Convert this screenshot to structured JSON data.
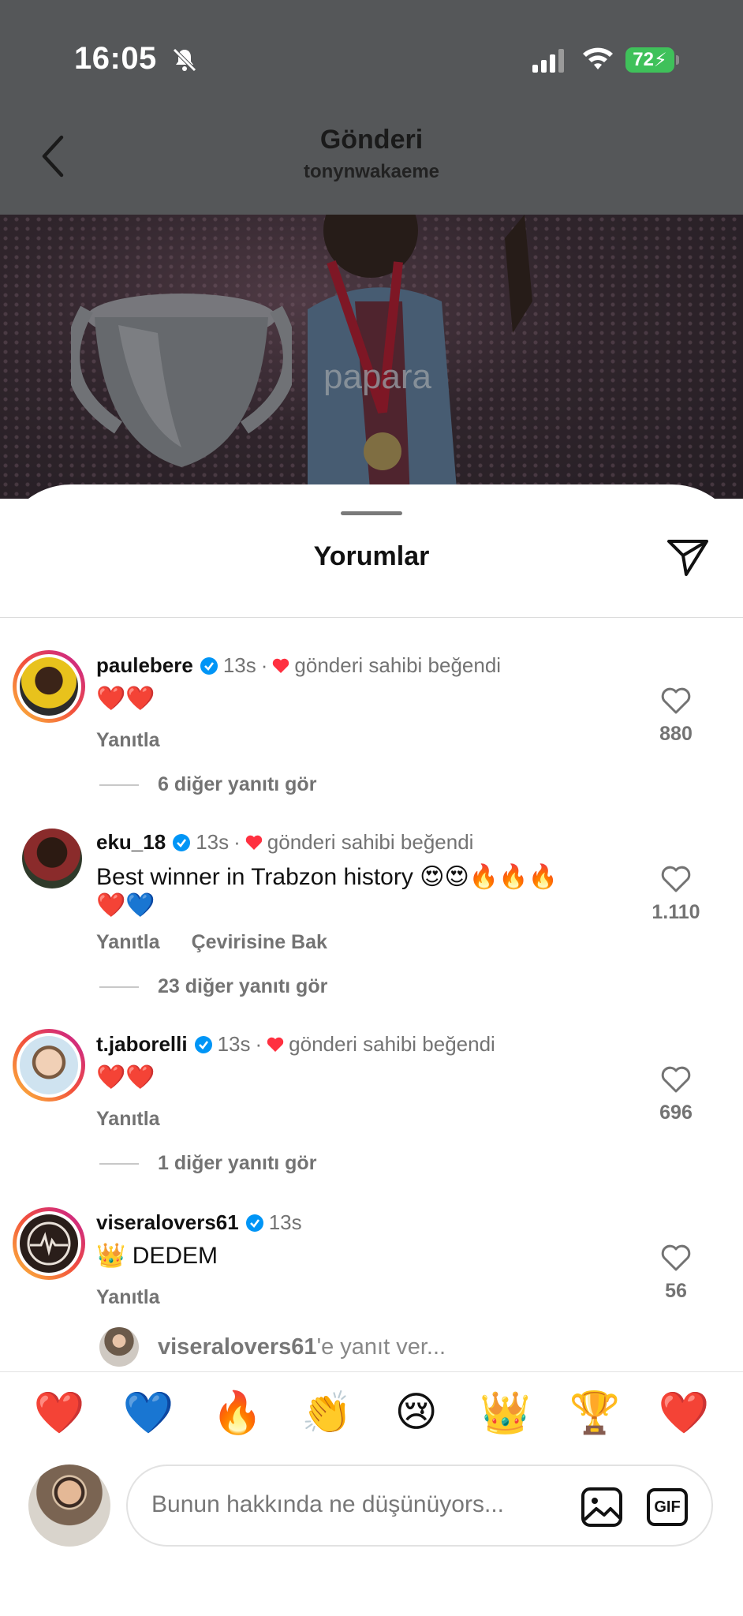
{
  "status_bar": {
    "time": "16:05",
    "battery": "72"
  },
  "header": {
    "title": "Gönderi",
    "subtitle": "tonynwakaeme"
  },
  "sheet": {
    "title": "Yorumlar"
  },
  "comments": [
    {
      "username": "paulebere",
      "time": "13s",
      "separator": "·",
      "liked_by_owner": "gönderi sahibi beğendi",
      "text": "❤️❤️",
      "reply": "Yanıtla",
      "likes": "880",
      "more_replies": "6 diğer yanıtı gör"
    },
    {
      "username": "eku_18",
      "time": "13s",
      "separator": "·",
      "liked_by_owner": "gönderi sahibi beğendi",
      "text": "Best winner in Trabzon history 😍😍🔥🔥🔥",
      "text2": "❤️💙",
      "reply": "Yanıtla",
      "translate": "Çevirisine Bak",
      "likes": "1.110",
      "more_replies": "23 diğer yanıtı gör"
    },
    {
      "username": "t.jaborelli",
      "time": "13s",
      "separator": "·",
      "liked_by_owner": "gönderi sahibi beğendi",
      "text": "❤️❤️",
      "reply": "Yanıtla",
      "likes": "696",
      "more_replies": "1 diğer yanıtı gör"
    },
    {
      "username": "viseralovers61",
      "time": "13s",
      "text": "👑 DEDEM",
      "reply": "Yanıtla",
      "likes": "56"
    }
  ],
  "reply_prompt": {
    "username": "viseralovers61",
    "suffix": "'e yanıt ver..."
  },
  "quick_emojis": [
    "❤️",
    "💙",
    "🔥",
    "👏",
    "😢",
    "👑",
    "🏆",
    "❤️"
  ],
  "composer": {
    "placeholder": "Bunun hakkında ne düşünüyors...",
    "gif_label": "GIF"
  },
  "colors": {
    "accent_heart": "#ff3040",
    "verified": "#0095f6",
    "battery": "#3fc15a"
  }
}
